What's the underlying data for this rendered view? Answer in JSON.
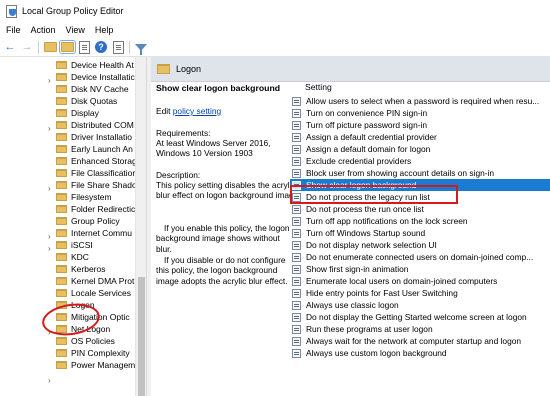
{
  "window": {
    "title": "Local Group Policy Editor",
    "icon": "group-policy-icon"
  },
  "menu": [
    "File",
    "Action",
    "View",
    "Help"
  ],
  "toolbar": {
    "icons": [
      "back-arrow-icon",
      "forward-arrow-icon",
      "up-folder-icon",
      "show-hide-tree-icon",
      "properties-icon",
      "help-icon",
      "filter-icon"
    ]
  },
  "tree": {
    "items": [
      {
        "label": "Device Health At",
        "expandable": false
      },
      {
        "label": "Device Installatic",
        "expandable": true
      },
      {
        "label": "Disk NV Cache",
        "expandable": false
      },
      {
        "label": "Disk Quotas",
        "expandable": false
      },
      {
        "label": "Display",
        "expandable": false
      },
      {
        "label": "Distributed COM",
        "expandable": true
      },
      {
        "label": "Driver Installatio",
        "expandable": false
      },
      {
        "label": "Early Launch An",
        "expandable": false
      },
      {
        "label": "Enhanced Storag",
        "expandable": false
      },
      {
        "label": "File Classificatior",
        "expandable": false
      },
      {
        "label": "File Share Shado",
        "expandable": false
      },
      {
        "label": "Filesystem",
        "expandable": true
      },
      {
        "label": "Folder Redirectic",
        "expandable": false
      },
      {
        "label": "Group Policy",
        "expandable": false
      },
      {
        "label": "Internet Commu",
        "expandable": true
      },
      {
        "label": "iSCSI",
        "expandable": true
      },
      {
        "label": "KDC",
        "expandable": false
      },
      {
        "label": "Kerberos",
        "expandable": false
      },
      {
        "label": "Kernel DMA Prot",
        "expandable": false
      },
      {
        "label": "Locale Services",
        "expandable": false
      },
      {
        "label": "Logon",
        "expandable": false
      },
      {
        "label": "Mitigation Optic",
        "expandable": false
      },
      {
        "label": "Net Logon",
        "expandable": true
      },
      {
        "label": "OS Policies",
        "expandable": false
      },
      {
        "label": "PIN Complexity",
        "expandable": false
      },
      {
        "label": "Power Managem",
        "expandable": true
      }
    ]
  },
  "pane": {
    "header": "Logon",
    "description": {
      "title": "Show clear logon background",
      "edit_prefix": "Edit",
      "edit_link": "policy setting",
      "requirements_heading": "Requirements:",
      "requirements": "At least Windows Server 2016, Windows 10 Version 1903",
      "description_heading": "Description:",
      "description": "This policy setting disables the acrylic blur effect on logon background image.",
      "paragraph1": "If you enable this policy, the logon background image shows without blur.",
      "paragraph2": "If you disable or do not configure this policy, the logon background image adopts the acrylic blur effect."
    },
    "setting_column": "Setting",
    "settings": [
      "Allow users to select when a password is required when resu...",
      "Turn on convenience PIN sign-in",
      "Turn off picture password sign-in",
      "Assign a default credential provider",
      "Assign a default domain for logon",
      "Exclude credential providers",
      "Block user from showing account details on sign-in",
      "Show clear logon background",
      "Do not process the legacy run list",
      "Do not process the run once list",
      "Turn off app notifications on the lock screen",
      "Turn off Windows Startup sound",
      "Do not display network selection UI",
      "Do not enumerate connected users on domain-joined comp...",
      "Show first sign-in animation",
      "Enumerate local users on domain-joined computers",
      "Hide entry points for Fast User Switching",
      "Always use classic logon",
      "Do not display the Getting Started welcome screen at logon",
      "Run these programs at user logon",
      "Always wait for the network at computer startup and logon",
      "Always use custom logon background"
    ],
    "selected_setting": "Show clear logon background"
  },
  "colors": {
    "selection": "#1a7bd2",
    "annotation": "#d41b1b",
    "link": "#0645ad"
  }
}
